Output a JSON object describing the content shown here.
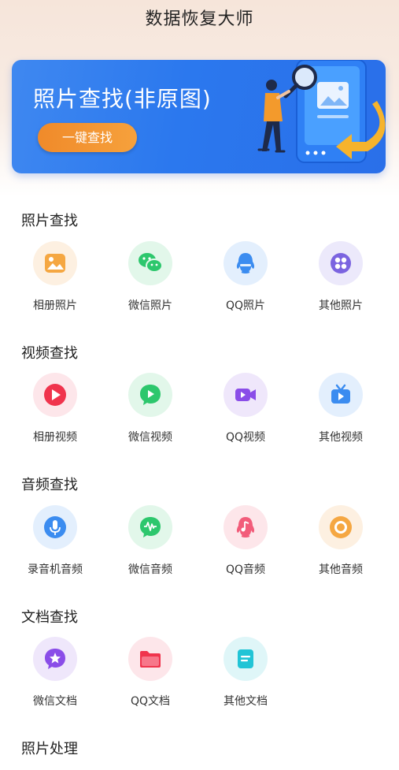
{
  "app_title": "数据恢复大师",
  "banner": {
    "title": "照片查找(非原图)",
    "button_label": "一键查找"
  },
  "sections": [
    {
      "title": "照片查找",
      "items": [
        {
          "label": "相册照片",
          "icon": "album-photo-icon"
        },
        {
          "label": "微信照片",
          "icon": "wechat-icon"
        },
        {
          "label": "QQ照片",
          "icon": "qq-icon"
        },
        {
          "label": "其他照片",
          "icon": "grid-dots-icon"
        }
      ]
    },
    {
      "title": "视频查找",
      "items": [
        {
          "label": "相册视频",
          "icon": "play-icon"
        },
        {
          "label": "微信视频",
          "icon": "wechat-video-icon"
        },
        {
          "label": "QQ视频",
          "icon": "video-camera-icon"
        },
        {
          "label": "其他视频",
          "icon": "tv-icon"
        }
      ]
    },
    {
      "title": "音频查找",
      "items": [
        {
          "label": "录音机音频",
          "icon": "microphone-icon"
        },
        {
          "label": "微信音频",
          "icon": "voice-wave-icon"
        },
        {
          "label": "QQ音频",
          "icon": "music-note-icon"
        },
        {
          "label": "其他音频",
          "icon": "record-icon"
        }
      ]
    },
    {
      "title": "文档查找",
      "items": [
        {
          "label": "微信文档",
          "icon": "star-chat-icon"
        },
        {
          "label": "QQ文档",
          "icon": "folder-icon"
        },
        {
          "label": "其他文档",
          "icon": "document-icon"
        }
      ]
    },
    {
      "title": "照片处理",
      "items": []
    }
  ],
  "colors": {
    "banner_blue": "#2b78ee",
    "button_orange": "#f39332",
    "orange": "#f5a742",
    "green": "#2dc76d",
    "blue": "#3b8cf0",
    "purple": "#7b64e0",
    "red": "#f0344d",
    "pink_red": "#f25c7a",
    "cyan": "#21c4d6"
  }
}
